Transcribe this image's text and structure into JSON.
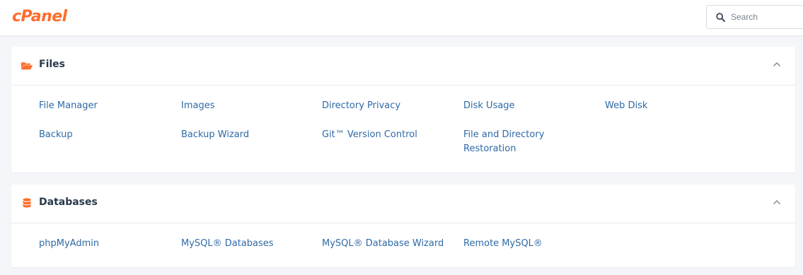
{
  "app": {
    "logo_text": "cPanel",
    "accent_color": "#ff6c2c",
    "link_color": "#2e6aa7"
  },
  "search": {
    "placeholder": "Search",
    "value": "",
    "icon": "search-icon"
  },
  "panels": [
    {
      "title": "Files",
      "icon": "folder-open-icon",
      "collapse_icon": "chevron-up-icon",
      "items": [
        "File Manager",
        "Images",
        "Directory Privacy",
        "Disk Usage",
        "Web Disk",
        "Backup",
        "Backup Wizard",
        "Git™ Version Control",
        "File and Directory Restoration"
      ]
    },
    {
      "title": "Databases",
      "icon": "database-icon",
      "collapse_icon": "chevron-up-icon",
      "items": [
        "phpMyAdmin",
        "MySQL® Databases",
        "MySQL® Database Wizard",
        "Remote MySQL®"
      ]
    }
  ]
}
